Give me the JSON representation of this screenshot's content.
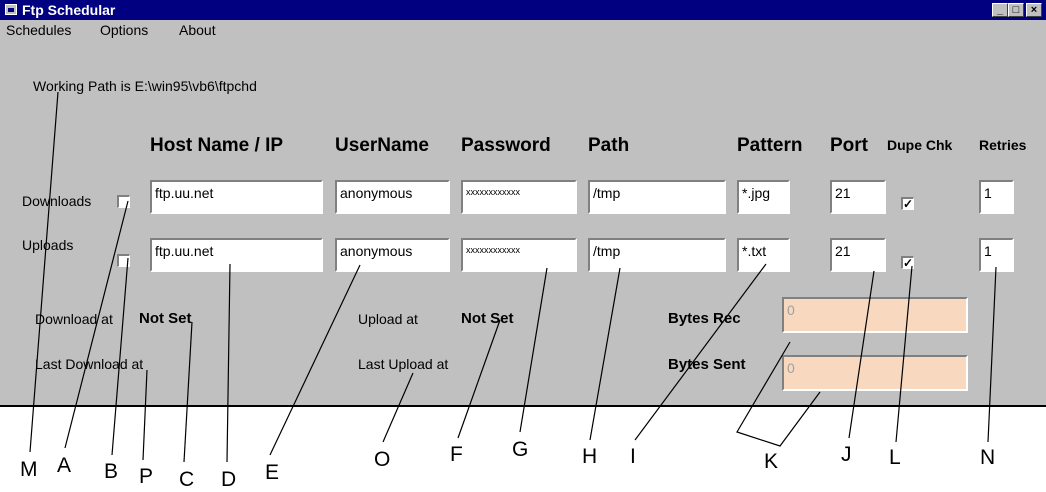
{
  "window": {
    "title": "Ftp Schedular"
  },
  "menu": [
    "Schedules",
    "Options",
    "About"
  ],
  "working_path": "Working Path is E:\\win95\\vb6\\ftpchd",
  "headers": {
    "host": "Host Name / IP",
    "user": "UserName",
    "password": "Password",
    "path": "Path",
    "pattern": "Pattern",
    "port": "Port",
    "dupe": "Dupe Chk",
    "retries": "Retries"
  },
  "downloads": {
    "label": "Downloads",
    "enabled": false,
    "host": "ftp.uu.net",
    "user": "anonymous",
    "password": "xxxxxxxxxxxx",
    "path": "/tmp",
    "pattern": "*.jpg",
    "port": "21",
    "dupe_check": true,
    "retries": "1"
  },
  "uploads": {
    "label": "Uploads",
    "enabled": false,
    "host": "ftp.uu.net",
    "user": "anonymous",
    "password": "xxxxxxxxxxxx",
    "path": "/tmp",
    "pattern": "*.txt",
    "port": "21",
    "dupe_check": true,
    "retries": "1"
  },
  "status": {
    "download_at_label": "Download at",
    "download_at_value": "Not Set",
    "upload_at_label": "Upload at",
    "upload_at_value": "Not Set",
    "last_download_label": "Last Download at",
    "last_upload_label": "Last Upload at",
    "bytes_rec_label": "Bytes Rec",
    "bytes_rec_value": "0",
    "bytes_sent_label": "Bytes Sent",
    "bytes_sent_value": "0"
  },
  "callouts": {
    "M": "M",
    "A": "A",
    "B": "B",
    "P": "P",
    "C": "C",
    "D": "D",
    "E": "E",
    "O": "O",
    "F": "F",
    "G": "G",
    "H": "H",
    "I": "I",
    "K": "K",
    "J": "J",
    "L": "L",
    "N": "N"
  },
  "colors": {
    "titlebar": "#000080",
    "face": "#c0c0c0",
    "disabled_field": "#f9d8c0"
  }
}
